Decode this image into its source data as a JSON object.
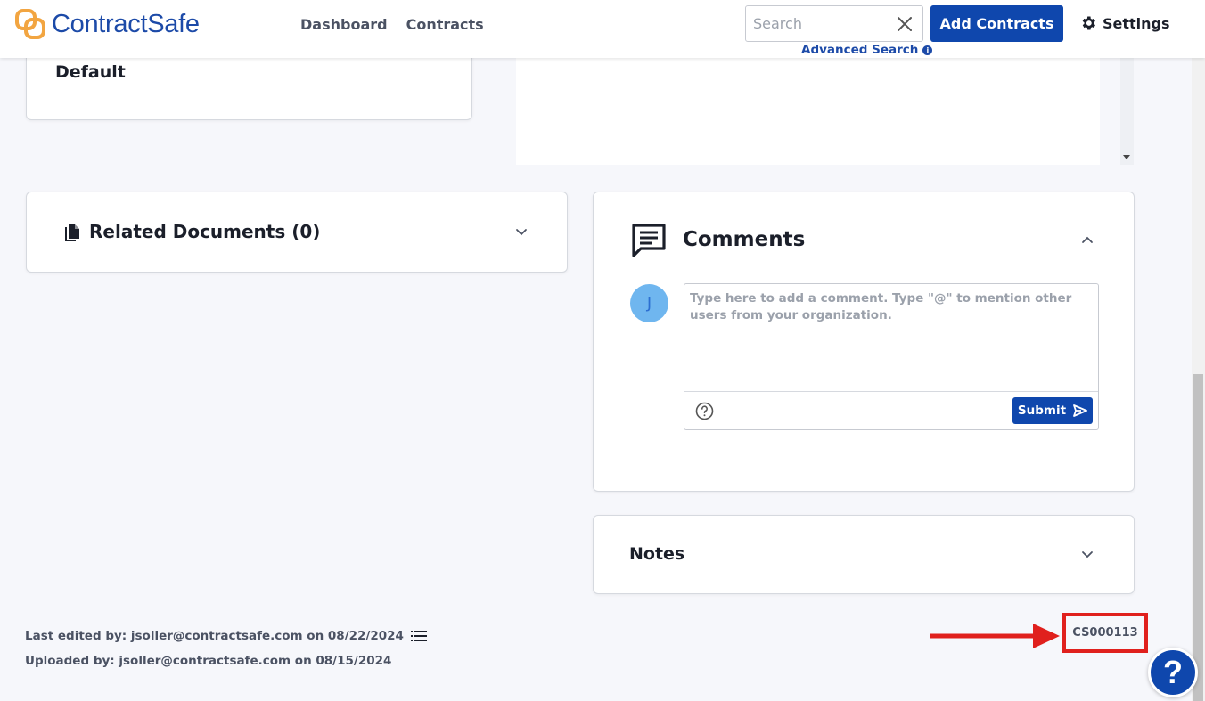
{
  "header": {
    "logo_text": "ContractSafe",
    "nav": [
      {
        "label": "Dashboard"
      },
      {
        "label": "Contracts"
      }
    ],
    "search": {
      "placeholder": "Search",
      "value": ""
    },
    "advanced_search_label": "Advanced Search",
    "add_contracts_label": "Add Contracts",
    "settings_label": "Settings"
  },
  "default_card": {
    "label": "Default"
  },
  "related_documents": {
    "title": "Related Documents (0)"
  },
  "comments": {
    "title": "Comments",
    "avatar_initial": "J",
    "input": {
      "placeholder": "Type here to add a comment. Type \"@\" to mention other users from your organization.",
      "value": ""
    },
    "submit_label": "Submit"
  },
  "notes": {
    "title": "Notes"
  },
  "footer": {
    "last_edited": "Last edited by: jsoller@contractsafe.com on 08/22/2024",
    "uploaded": "Uploaded by: jsoller@contractsafe.com on 08/15/2024",
    "contract_id": "CS000113"
  },
  "help_fab_label": "?",
  "colors": {
    "brand_blue": "#0f47ad",
    "logo_orange": "#f2a541",
    "highlight_red": "#e0201d"
  }
}
